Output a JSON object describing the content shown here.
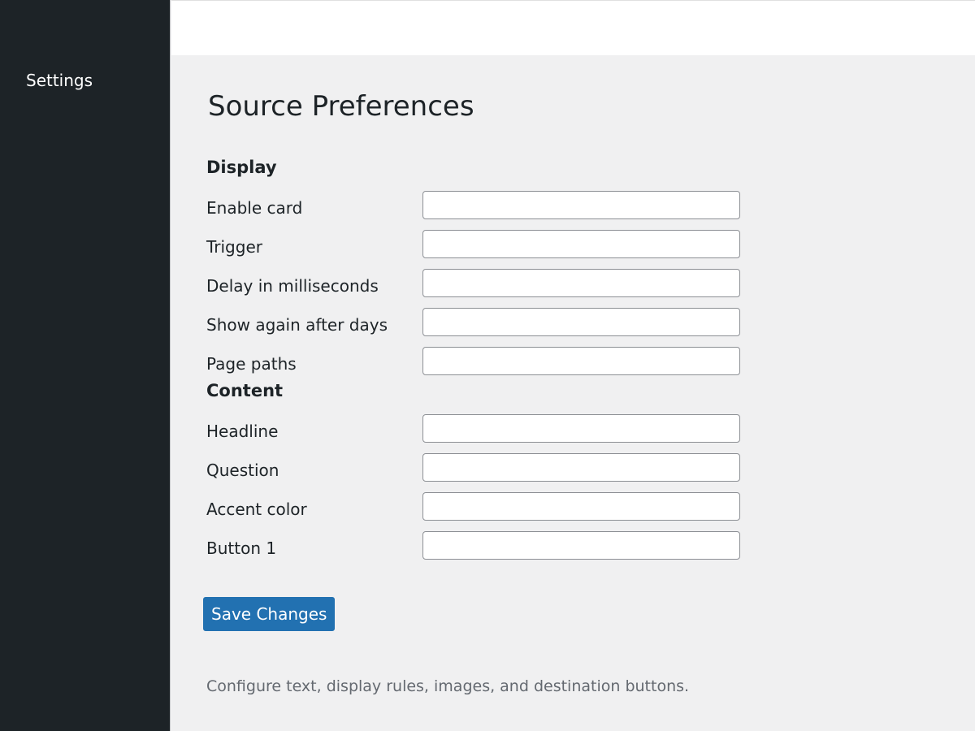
{
  "sidebar": {
    "items": [
      {
        "label": "Settings"
      }
    ]
  },
  "page": {
    "title": "Source Preferences"
  },
  "sections": {
    "display": {
      "heading": "Display",
      "fields": [
        {
          "label": "Enable card",
          "value": ""
        },
        {
          "label": "Trigger",
          "value": ""
        },
        {
          "label": "Delay in milliseconds",
          "value": ""
        },
        {
          "label": "Show again after days",
          "value": ""
        },
        {
          "label": "Page paths",
          "value": ""
        }
      ]
    },
    "content": {
      "heading": "Content",
      "fields": [
        {
          "label": "Headline",
          "value": ""
        },
        {
          "label": "Question",
          "value": ""
        },
        {
          "label": "Accent color",
          "value": ""
        },
        {
          "label": "Button 1",
          "value": ""
        }
      ]
    }
  },
  "actions": {
    "save_label": "Save Changes"
  },
  "footer": {
    "description": "Configure text, display rules, images, and destination buttons."
  },
  "colors": {
    "sidebar_bg": "#1d2327",
    "page_bg": "#f0f0f1",
    "accent": "#2271b1"
  }
}
